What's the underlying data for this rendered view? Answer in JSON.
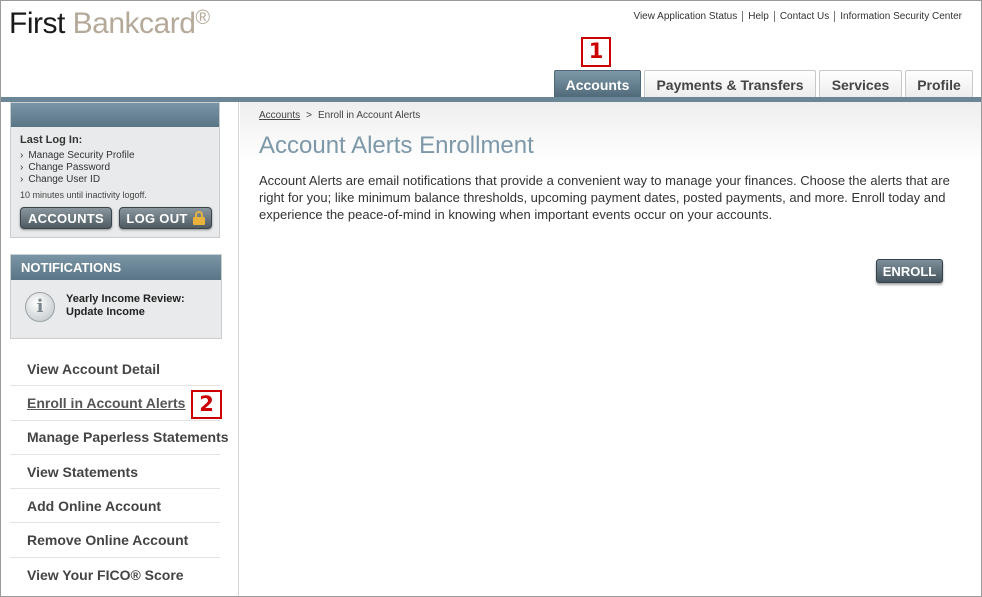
{
  "logo": {
    "first": "First",
    "bankcard": " Bankcard",
    "reg": "®"
  },
  "utility_links": [
    "View Application Status",
    "Help",
    "Contact Us",
    "Information Security Center"
  ],
  "tabs": [
    {
      "label": "Accounts",
      "active": true
    },
    {
      "label": "Payments & Transfers",
      "active": false
    },
    {
      "label": "Services",
      "active": false
    },
    {
      "label": "Profile",
      "active": false
    }
  ],
  "markers": [
    "1",
    "2"
  ],
  "login": {
    "heading": "Last Log In:",
    "links": [
      "Manage Security Profile",
      "Change Password",
      "Change User ID"
    ],
    "inactivity": "10 minutes until inactivity logoff.",
    "accounts_button": "ACCOUNTS",
    "logout_button": "LOG OUT"
  },
  "notifications": {
    "heading": "NOTIFICATIONS",
    "icon_glyph": "i",
    "line1": "Yearly Income Review:",
    "line2": "Update Income"
  },
  "nav": [
    "View Account Detail",
    "Enroll in Account Alerts",
    "Manage Paperless Statements",
    "View Statements",
    "Add Online Account",
    "Remove Online Account",
    "View Your FICO® Score"
  ],
  "breadcrumb": {
    "root": "Accounts",
    "separator": ">",
    "current": "Enroll in Account Alerts"
  },
  "page_title": "Account Alerts Enrollment",
  "description": "Account Alerts are email notifications that provide a convenient way to manage your finances. Choose the alerts that are right for you; like minimum balance thresholds, upcoming payment dates, posted payments, and more. Enroll today and experience the peace-of-mind in knowing when important events occur on your accounts.",
  "enroll_button": "ENROLL",
  "colors": {
    "accent": "#7c98a9",
    "tab_active": "#5a7585",
    "marker": "#cc0000",
    "logo_gray": "#b5a99a"
  }
}
